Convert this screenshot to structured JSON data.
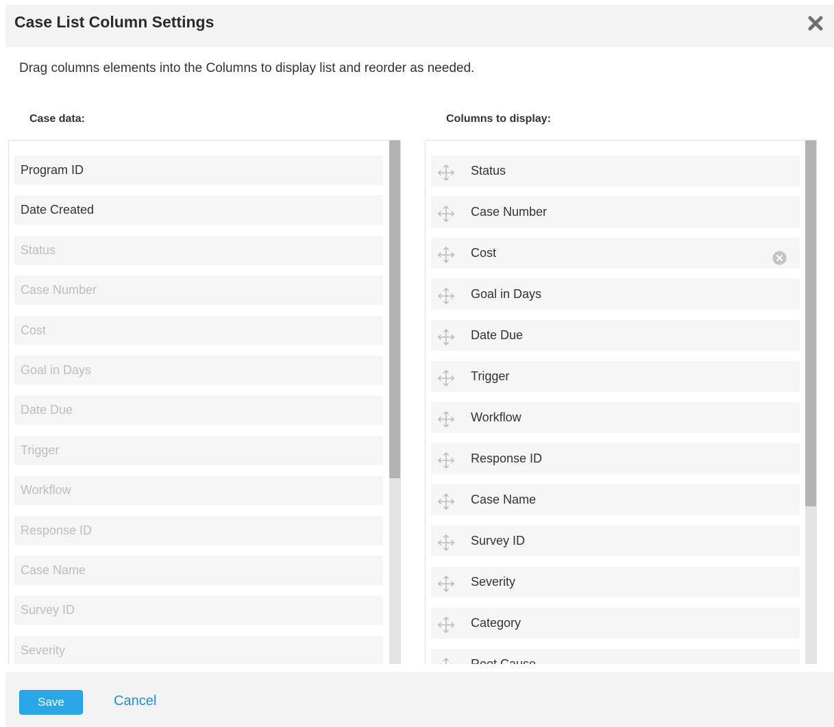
{
  "dialog": {
    "title": "Case List Column Settings",
    "instructions": "Drag columns elements into the Columns to display list and reorder as needed."
  },
  "case_data": {
    "label": "Case data:",
    "items": [
      {
        "label": "Program ID",
        "available": true
      },
      {
        "label": "Date Created",
        "available": true
      },
      {
        "label": "Status",
        "available": false
      },
      {
        "label": "Case Number",
        "available": false
      },
      {
        "label": "Cost",
        "available": false
      },
      {
        "label": "Goal in Days",
        "available": false
      },
      {
        "label": "Date Due",
        "available": false
      },
      {
        "label": "Trigger",
        "available": false
      },
      {
        "label": "Workflow",
        "available": false
      },
      {
        "label": "Response ID",
        "available": false
      },
      {
        "label": "Case Name",
        "available": false
      },
      {
        "label": "Survey ID",
        "available": false
      },
      {
        "label": "Severity",
        "available": false
      }
    ]
  },
  "columns_to_display": {
    "label": "Columns to display:",
    "items": [
      {
        "label": "Status"
      },
      {
        "label": "Case Number"
      },
      {
        "label": "Cost",
        "hovered": true
      },
      {
        "label": "Goal in Days"
      },
      {
        "label": "Date Due"
      },
      {
        "label": "Trigger"
      },
      {
        "label": "Workflow"
      },
      {
        "label": "Response ID"
      },
      {
        "label": "Case Name"
      },
      {
        "label": "Survey ID"
      },
      {
        "label": "Severity"
      },
      {
        "label": "Category"
      },
      {
        "label": "Root Cause"
      }
    ]
  },
  "footer": {
    "save_label": "Save",
    "cancel_label": "Cancel"
  },
  "icons": {
    "close": "close-icon",
    "drag": "drag-handle-icon",
    "remove": "remove-circle-icon"
  },
  "colors": {
    "accent": "#2aa8e6",
    "link": "#1f8fd3",
    "disabled_text": "#bdbdbd",
    "header_bg": "#f3f3f3"
  }
}
